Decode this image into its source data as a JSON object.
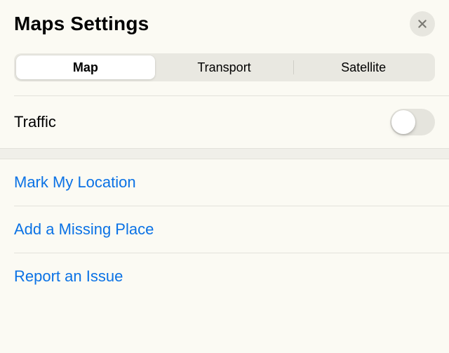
{
  "header": {
    "title": "Maps Settings"
  },
  "segment": {
    "items": [
      "Map",
      "Transport",
      "Satellite"
    ],
    "selected_index": 0
  },
  "traffic": {
    "label": "Traffic",
    "on": false
  },
  "actions": [
    "Mark My Location",
    "Add a Missing Place",
    "Report an Issue"
  ]
}
